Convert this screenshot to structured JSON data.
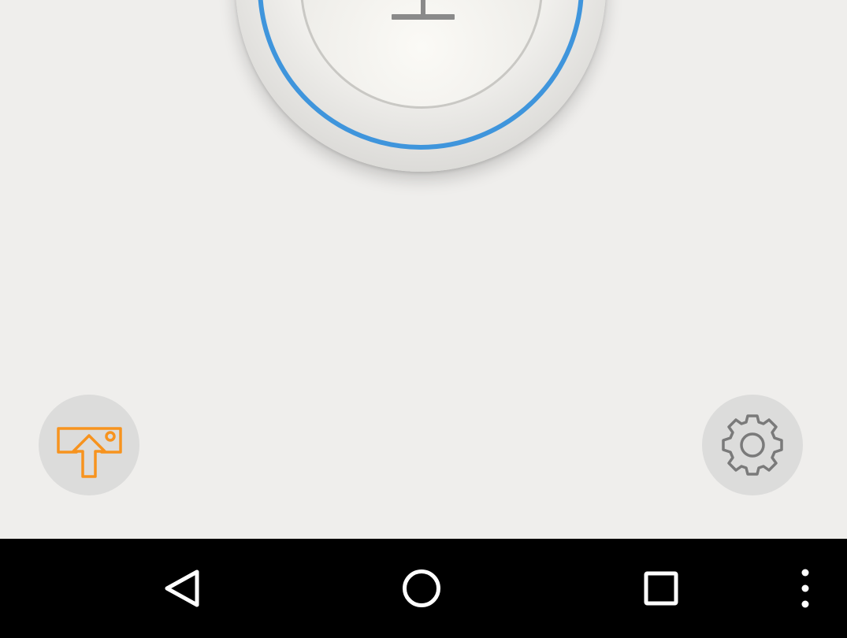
{
  "screen": {
    "background_color": "#efeeec"
  },
  "mic_button": {
    "icon": "microphone-icon",
    "ring_color": "#3f95dc"
  },
  "action_buttons": {
    "upload": {
      "icon": "upload-to-screen-icon",
      "icon_color": "#f7931e"
    },
    "settings": {
      "icon": "gear-icon",
      "icon_color": "#7a7a7a"
    }
  },
  "nav_bar": {
    "background_color": "#000000",
    "items": [
      {
        "icon": "back-triangle-icon"
      },
      {
        "icon": "home-circle-icon"
      },
      {
        "icon": "recents-square-icon"
      },
      {
        "icon": "overflow-menu-icon"
      }
    ]
  }
}
